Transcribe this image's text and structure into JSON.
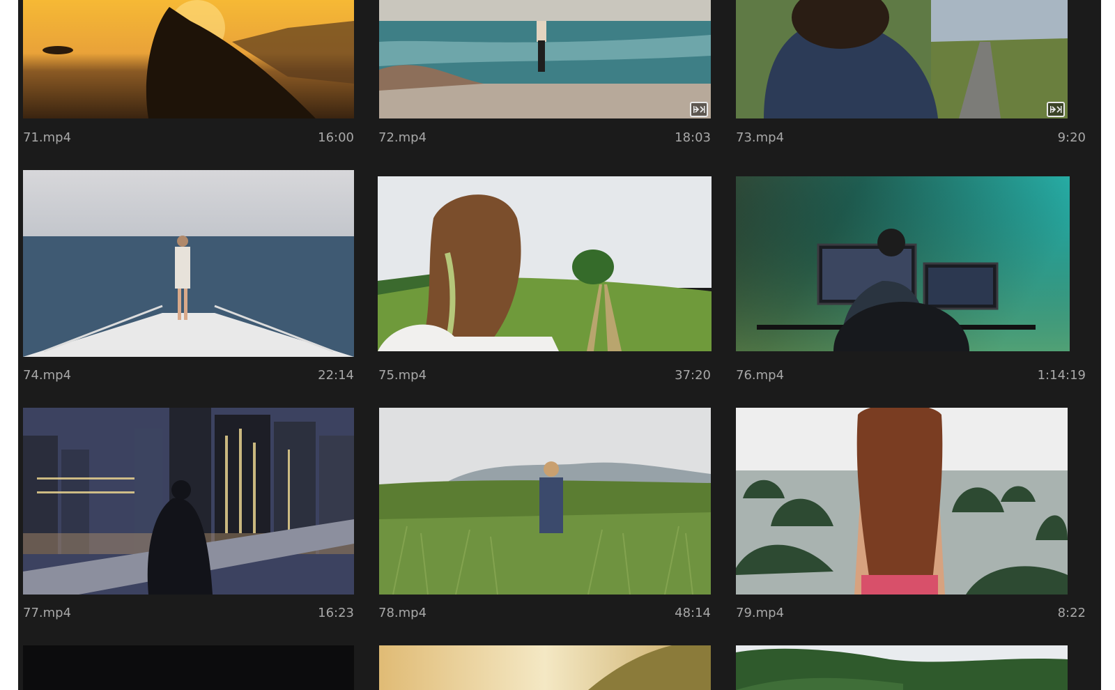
{
  "clips": [
    {
      "name": "71.mp4",
      "duration": "16:00",
      "badge": false,
      "scene": "sunset-rock"
    },
    {
      "name": "72.mp4",
      "duration": "18:03",
      "badge": true,
      "badge_icon": "transition-icon",
      "scene": "beach-yoga"
    },
    {
      "name": "73.mp4",
      "duration": "9:20",
      "badge": true,
      "badge_icon": "transition-icon",
      "scene": "country-path"
    },
    {
      "name": "74.mp4",
      "duration": "22:14",
      "badge": false,
      "scene": "boat-bow"
    },
    {
      "name": "75.mp4",
      "duration": "37:20",
      "badge": false,
      "scene": "meadow-tree"
    },
    {
      "name": "76.mp4",
      "duration": "1:14:19",
      "badge": false,
      "scene": "editor-desk"
    },
    {
      "name": "77.mp4",
      "duration": "16:23",
      "badge": false,
      "scene": "city-night"
    },
    {
      "name": "78.mp4",
      "duration": "48:14",
      "badge": false,
      "scene": "tall-grass"
    },
    {
      "name": "79.mp4",
      "duration": "8:22",
      "badge": false,
      "scene": "bay-islands"
    },
    {
      "name": "",
      "duration": "",
      "badge": false,
      "scene": "dark"
    },
    {
      "name": "",
      "duration": "",
      "badge": false,
      "scene": "hill-glow"
    },
    {
      "name": "",
      "duration": "",
      "badge": false,
      "scene": "green-hills"
    }
  ],
  "colors": {
    "panel_bg": "#1b1b1b",
    "label_text": "#a8a8a8",
    "badge_border": "#e8e8e8"
  }
}
